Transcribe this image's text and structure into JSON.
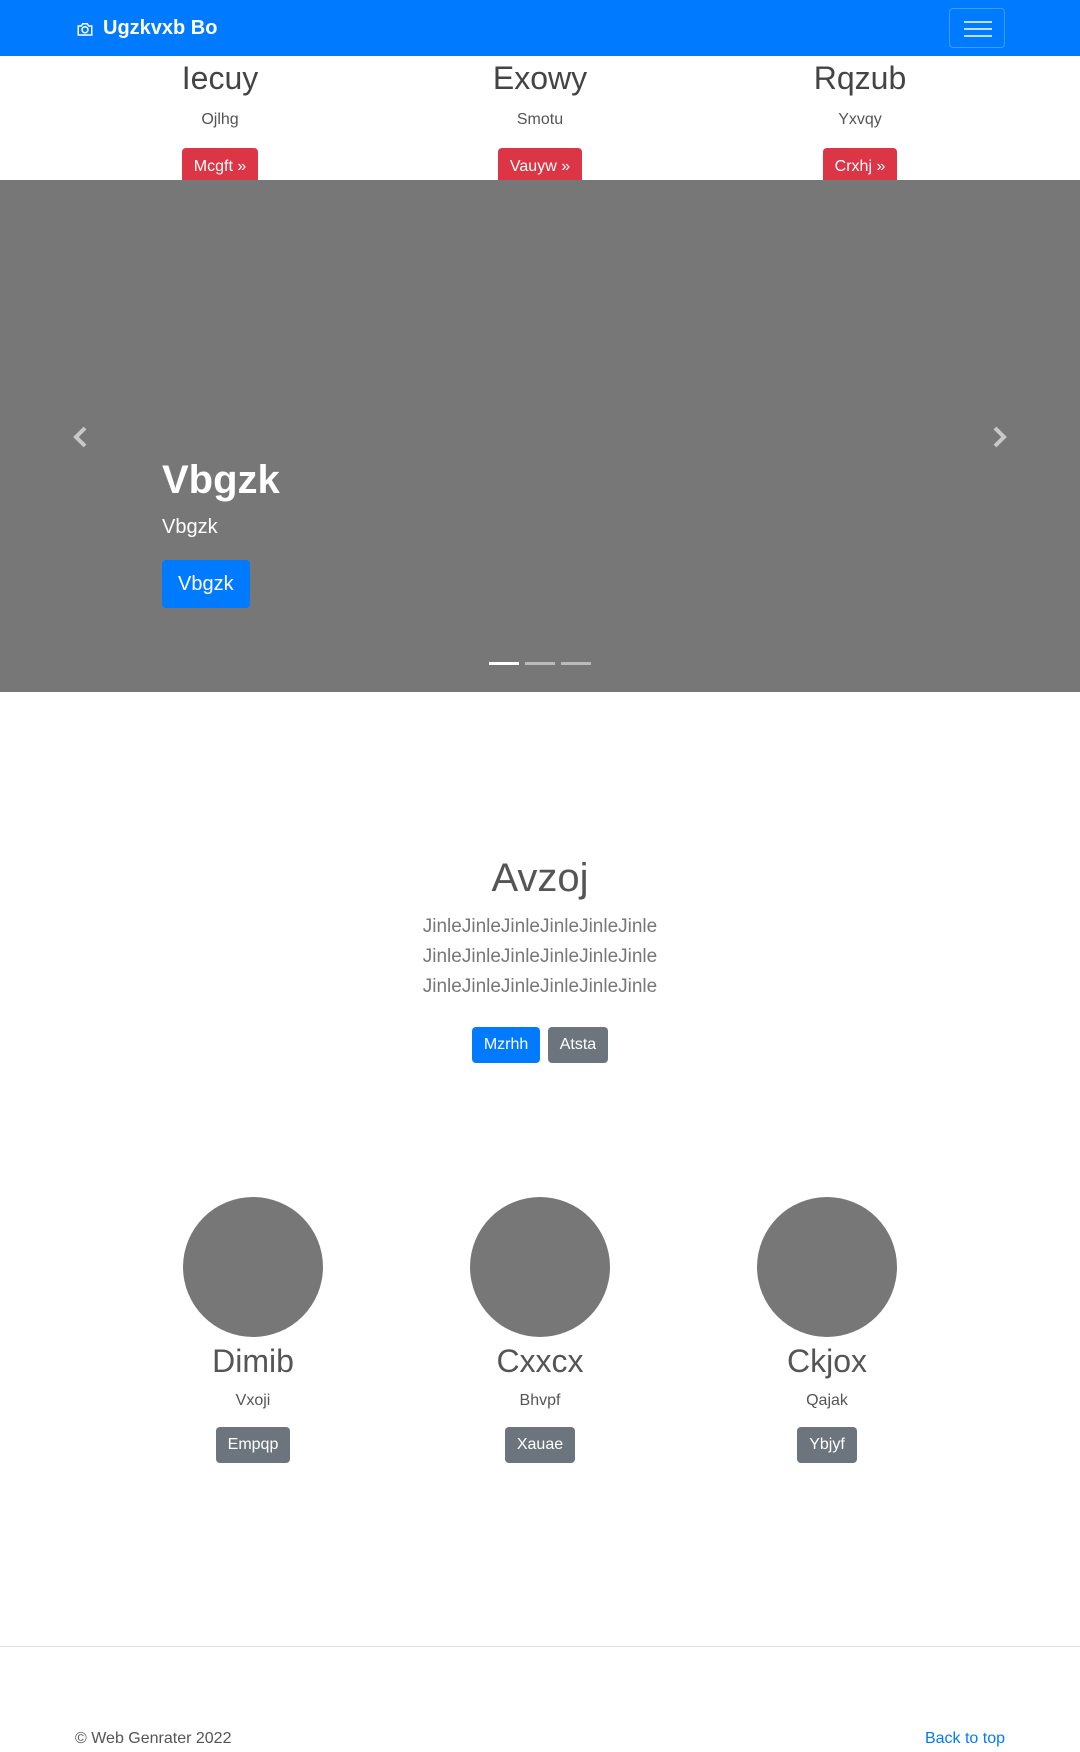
{
  "navbar": {
    "brand": "Ugzkvxb Bo",
    "brand_icon": "camera-icon",
    "toggler_icon": "hamburger-icon",
    "color": "#007bff"
  },
  "features": [
    {
      "title": "Iecuy",
      "text": "Ojlhg",
      "button": "Mcgft »"
    },
    {
      "title": "Exowy",
      "text": "Smotu",
      "button": "Vauyw »"
    },
    {
      "title": "Rqzub",
      "text": "Yxvqy",
      "button": "Crxhj »"
    }
  ],
  "carousel": {
    "title": "Vbgzk",
    "subtitle": "Vbgzk",
    "button": "Vbgzk",
    "prev_icon": "chevron-left-icon",
    "next_icon": "chevron-right-icon",
    "slides": 3,
    "active_slide": 1
  },
  "hero": {
    "title": "Avzoj",
    "text": "JinleJinleJinleJinleJinleJinle JinleJinleJinleJinleJinleJinle JinleJinleJinleJinleJinleJinle",
    "primary_button": "Mzrhh",
    "secondary_button": "Atsta"
  },
  "people": [
    {
      "name": "Dimib",
      "text": "Vxoji",
      "button": "Empqp"
    },
    {
      "name": "Cxxcx",
      "text": "Bhvpf",
      "button": "Xauae"
    },
    {
      "name": "Ckjox",
      "text": "Qajak",
      "button": "Ybjyf"
    }
  ],
  "footer": {
    "copyright": "© Web Genrater 2022",
    "back_to_top": "Back to top"
  }
}
